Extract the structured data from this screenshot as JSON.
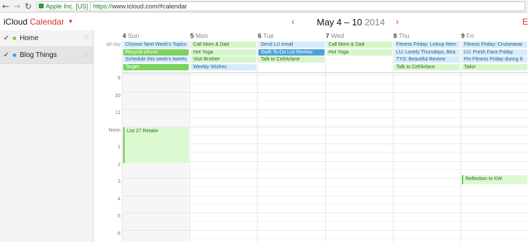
{
  "browser": {
    "back": "←",
    "forward": "→",
    "reload": "↻",
    "ev_label": "Apple Inc. [US]",
    "url_scheme": "https://",
    "url_rest": "www.icloud.com/#calendar"
  },
  "app": {
    "brand": "iCloud",
    "app_name": "Calendar",
    "prev": "‹",
    "next": "›",
    "week_range": "May 4 – 10",
    "year": "2014",
    "edge_glyph": "E"
  },
  "sidebar": {
    "items": [
      {
        "label": "Home",
        "color": "#7dc94f",
        "checked": "✓",
        "selected": false
      },
      {
        "label": "Blog Things",
        "color": "#3a9fd8",
        "checked": "✓",
        "selected": true
      }
    ],
    "share_glyph": "))"
  },
  "grid": {
    "allday_label": "all-day",
    "days": [
      {
        "num": "4",
        "name": "Sun"
      },
      {
        "num": "5",
        "name": "Mon"
      },
      {
        "num": "6",
        "name": "Tue"
      },
      {
        "num": "7",
        "name": "Wed"
      },
      {
        "num": "8",
        "name": "Thu"
      },
      {
        "num": "9",
        "name": "Fri"
      }
    ],
    "hours": [
      "9",
      "10",
      "11",
      "Noon",
      "1",
      "2",
      "3",
      "4",
      "5",
      "6"
    ],
    "allday_events": [
      [
        {
          "title": "Choose Next Week's Topics",
          "style": "blue"
        },
        {
          "title": "Recycle phone",
          "style": "solid-green"
        },
        {
          "title": "Schedule this week's tweets",
          "style": "blue"
        },
        {
          "title": "Target",
          "style": "solid-green"
        }
      ],
      [
        {
          "title": "Call Mom & Dad",
          "style": "green"
        },
        {
          "title": "Hot Yoga",
          "style": "green"
        },
        {
          "title": "Visit Brother",
          "style": "green"
        },
        {
          "title": "Weekly Wishes",
          "style": "blue"
        }
      ],
      [
        {
          "title": "Send LU email",
          "style": "blue"
        },
        {
          "title": "Swift To-Do List Review",
          "style": "solid-blue"
        },
        {
          "title": "Talk to Cef/Arlane",
          "style": "green"
        }
      ],
      [
        {
          "title": "Call Mom & Dad",
          "style": "green"
        },
        {
          "title": "Hot Yoga",
          "style": "green"
        }
      ],
      [
        {
          "title": "Fitness Friday: Linkup Rem",
          "style": "blue"
        },
        {
          "title": "LU: Lovely Thursdays, Bea",
          "style": "blue"
        },
        {
          "title": "TYS: Beautiful Review",
          "style": "blue"
        },
        {
          "title": "Talk to Cef/Arlane",
          "style": "green"
        }
      ],
      [
        {
          "title": "Fitness Friday: Cruisewear",
          "style": "blue"
        },
        {
          "title": "LU: Fresh Face Friday",
          "style": "blue"
        },
        {
          "title": "Pin Fitness Friday during 8",
          "style": "blue"
        },
        {
          "title": "Tailor",
          "style": "green"
        }
      ]
    ],
    "timed_events": [
      {
        "title": "List 27 Retake",
        "day": 0
      },
      {
        "title": "Reflection to KW",
        "day": 5
      }
    ]
  }
}
